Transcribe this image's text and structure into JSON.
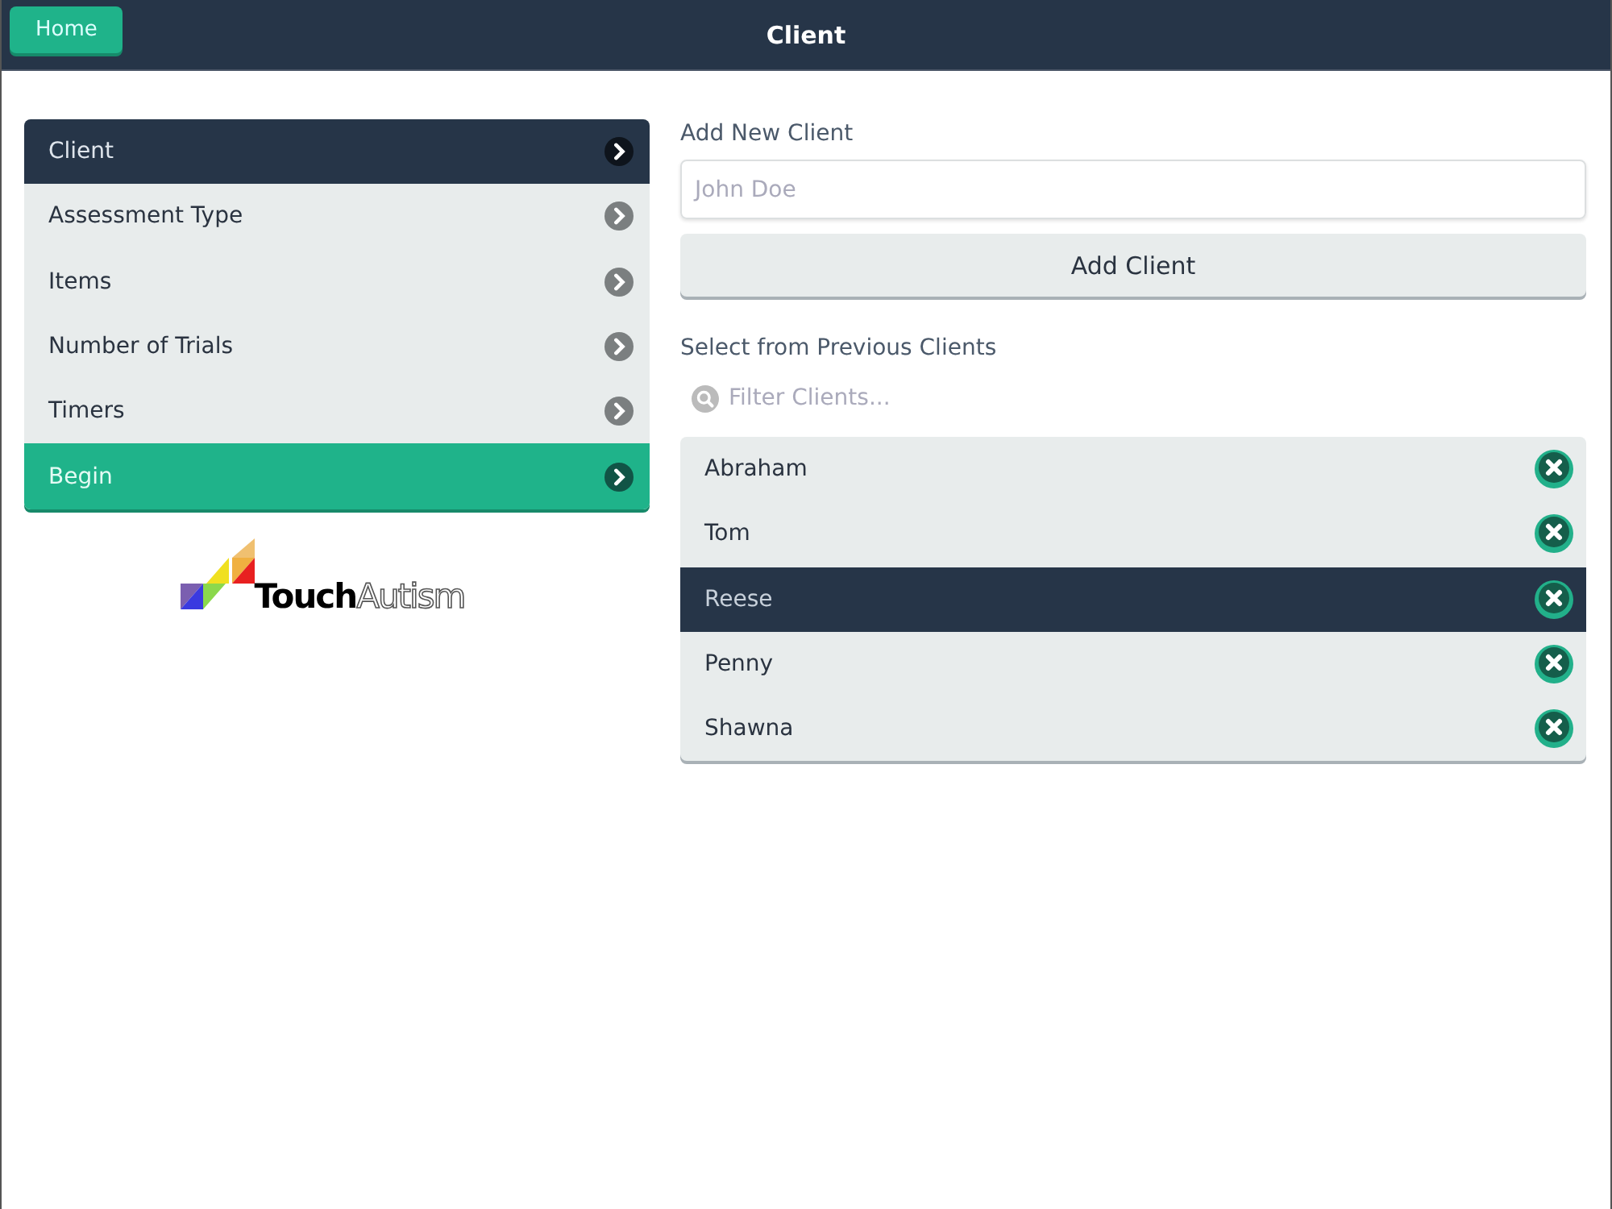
{
  "header": {
    "title": "Client",
    "home_button": "Home"
  },
  "menu": [
    {
      "label": "Client",
      "kind": "nav",
      "selected": true
    },
    {
      "label": "Assessment Type",
      "kind": "nav",
      "selected": false
    },
    {
      "label": "Items",
      "kind": "nav",
      "selected": false
    },
    {
      "label": "Number of Trials",
      "kind": "nav",
      "selected": false
    },
    {
      "label": "Timers",
      "kind": "nav",
      "selected": false
    },
    {
      "label": "Begin",
      "kind": "action",
      "selected": false
    }
  ],
  "logo": {
    "bold": "Touch",
    "outline": "Autism"
  },
  "new_client": {
    "heading": "Add New Client",
    "placeholder": "John Doe",
    "button": "Add Client"
  },
  "previous": {
    "heading": "Select from Previous Clients",
    "filter_placeholder": "Filter Clients...",
    "clients": [
      {
        "name": "Abraham",
        "selected": false
      },
      {
        "name": "Tom",
        "selected": false
      },
      {
        "name": "Reese",
        "selected": true
      },
      {
        "name": "Penny",
        "selected": false
      },
      {
        "name": "Shawna",
        "selected": false
      }
    ]
  }
}
